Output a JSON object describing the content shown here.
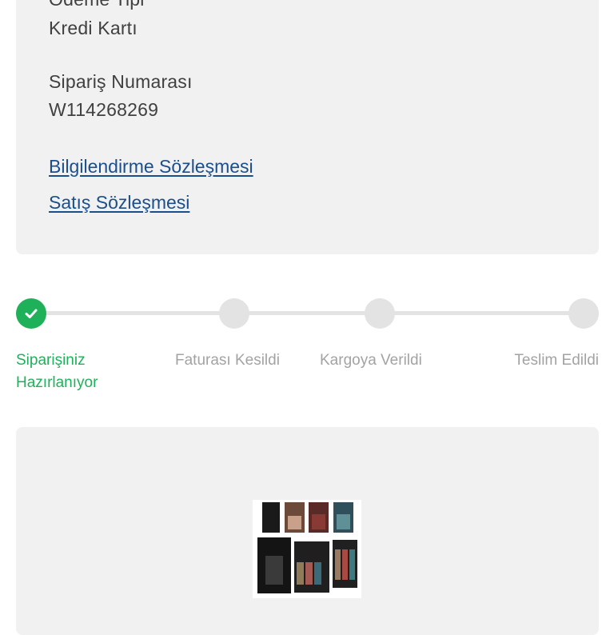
{
  "order_info": {
    "payment_type_label": "Ödeme Tipi",
    "payment_type_value": "Kredi Kartı",
    "order_number_label": "Sipariş Numarası",
    "order_number_value": "W114268269"
  },
  "links": {
    "info_agreement": "Bilgilendirme Sözleşmesi",
    "sales_agreement": "Satış Sözleşmesi"
  },
  "progress": {
    "steps": [
      {
        "label": "Siparişiniz Hazırlanıyor",
        "status": "done"
      },
      {
        "label": "Faturası Kesildi",
        "status": "pending"
      },
      {
        "label": "Kargoya Verildi",
        "status": "pending"
      },
      {
        "label": "Teslim Edildi",
        "status": "pending"
      }
    ]
  },
  "colors": {
    "accent_green": "#1fb15a",
    "link_blue": "#1b4f8c",
    "card_bg": "#f1f1f1",
    "inactive_gray": "#e3e3e3"
  }
}
